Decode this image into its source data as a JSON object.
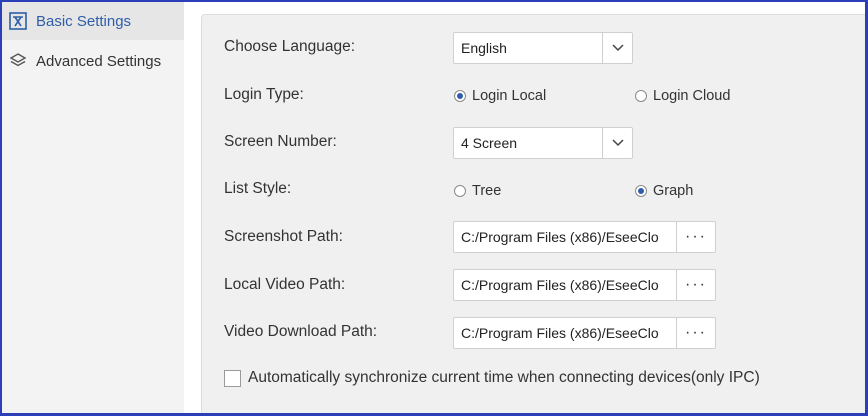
{
  "sidebar": {
    "items": [
      {
        "label": "Basic Settings",
        "icon": "basic-settings-icon",
        "active": true
      },
      {
        "label": "Advanced Settings",
        "icon": "layers-icon",
        "active": false
      }
    ]
  },
  "form": {
    "language": {
      "label": "Choose Language:",
      "value": "English"
    },
    "login_type": {
      "label": "Login Type:",
      "options": [
        {
          "label": "Login Local",
          "selected": true
        },
        {
          "label": "Login Cloud",
          "selected": false
        }
      ]
    },
    "screen_number": {
      "label": "Screen Number:",
      "value": "4 Screen"
    },
    "list_style": {
      "label": "List Style:",
      "options": [
        {
          "label": "Tree",
          "selected": false
        },
        {
          "label": "Graph",
          "selected": true
        }
      ]
    },
    "screenshot_path": {
      "label": "Screenshot Path:",
      "value": "C:/Program Files (x86)/EseeClo",
      "browse_label": "···"
    },
    "local_video_path": {
      "label": "Local Video Path:",
      "value": "C:/Program Files (x86)/EseeClo",
      "browse_label": "···"
    },
    "video_download_path": {
      "label": "Video Download Path:",
      "value": "C:/Program Files (x86)/EseeClo",
      "browse_label": "···"
    },
    "auto_sync": {
      "label": "Automatically synchronize current time when connecting devices(only IPC)",
      "checked": false
    }
  },
  "colors": {
    "accent": "#2e5ea8",
    "frame": "#2b3fb8"
  }
}
